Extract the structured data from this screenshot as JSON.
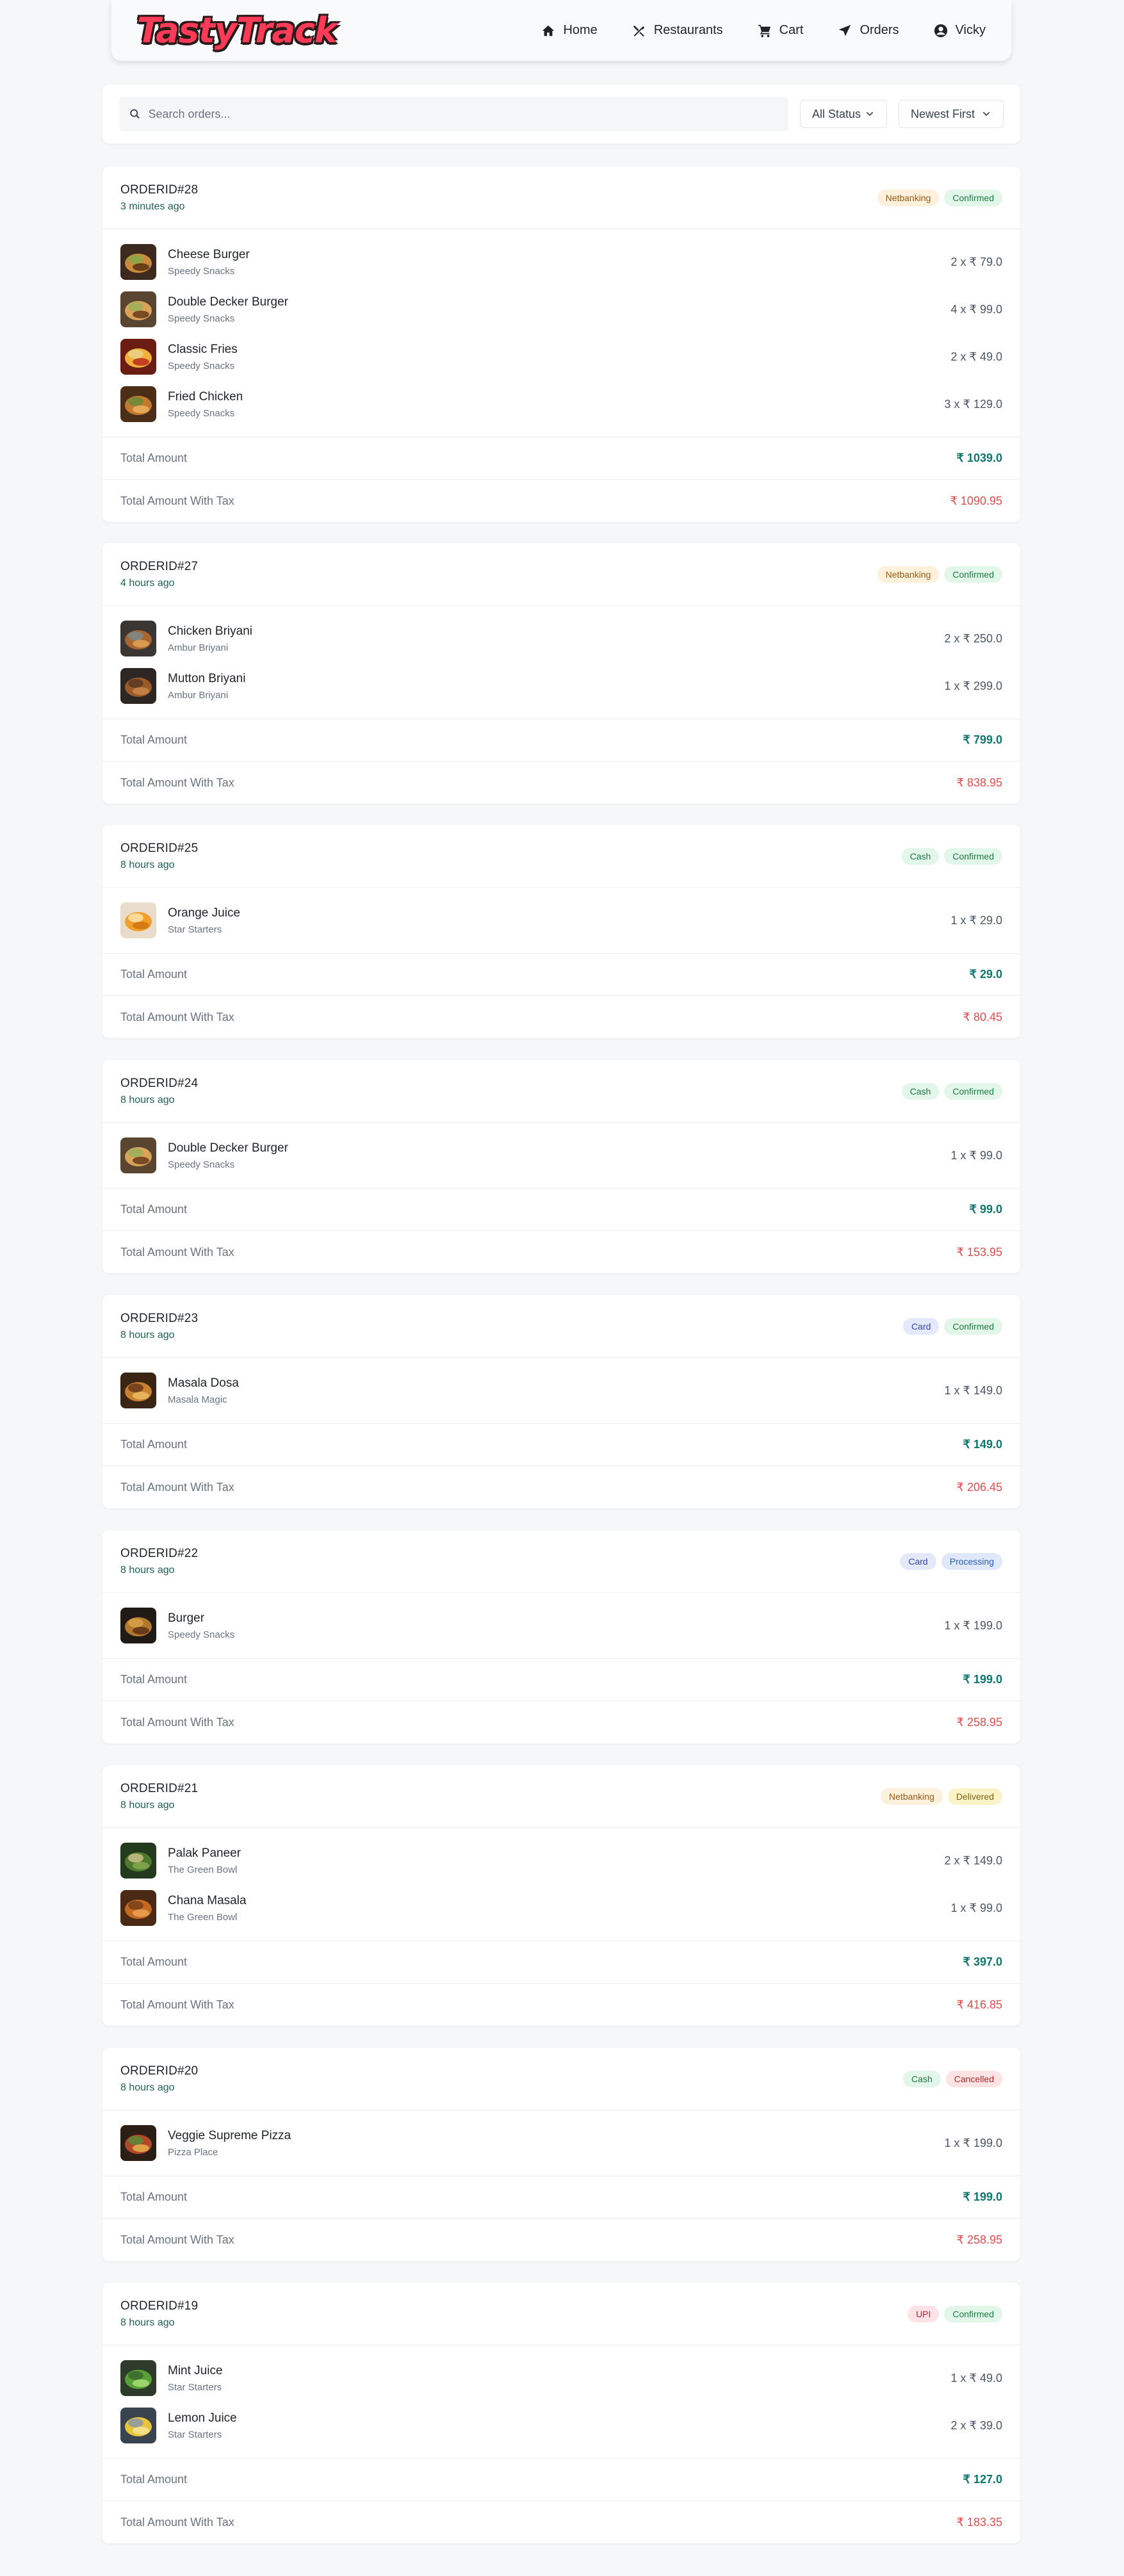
{
  "nav": {
    "logo": "TastyTrack",
    "links": [
      "Home",
      "Restaurants",
      "Cart",
      "Orders",
      "Vicky"
    ]
  },
  "toolbar": {
    "search_placeholder": "Search orders...",
    "status_filter": "All Status",
    "sort": "Newest First"
  },
  "labels": {
    "total": "Total Amount",
    "total_tax": "Total Amount With Tax"
  },
  "badge_colors": {
    "Netbanking": {
      "bg": "#fdf1dc",
      "fg": "#9a5a12"
    },
    "Cash": {
      "bg": "#e3f6ea",
      "fg": "#1e7a45"
    },
    "Card": {
      "bg": "#e3e8fb",
      "fg": "#3447a8"
    },
    "UPI": {
      "bg": "#fde3e8",
      "fg": "#b4283c"
    },
    "Confirmed": {
      "bg": "#e3f6ea",
      "fg": "#1e7a45"
    },
    "Processing": {
      "bg": "#dfe9fb",
      "fg": "#2b5cb8"
    },
    "Delivered": {
      "bg": "#fbf3c8",
      "fg": "#7a6410"
    },
    "Cancelled": {
      "bg": "#fde3e3",
      "fg": "#b42828"
    }
  },
  "orders": [
    {
      "id": "ORDERID#28",
      "time": "3 minutes ago",
      "payment": "Netbanking",
      "status": "Confirmed",
      "items": [
        {
          "name": "Cheese Burger",
          "restaurant": "Speedy Snacks",
          "qty": "2 x ₹ 79.0",
          "thumb": "burger"
        },
        {
          "name": "Double Decker Burger",
          "restaurant": "Speedy Snacks",
          "qty": "4 x ₹ 99.0",
          "thumb": "burger2"
        },
        {
          "name": "Classic Fries",
          "restaurant": "Speedy Snacks",
          "qty": "2 x ₹ 49.0",
          "thumb": "fries"
        },
        {
          "name": "Fried Chicken",
          "restaurant": "Speedy Snacks",
          "qty": "3 x ₹ 129.0",
          "thumb": "chicken"
        }
      ],
      "total": "₹ 1039.0",
      "total_tax": "₹ 1090.95"
    },
    {
      "id": "ORDERID#27",
      "time": "4 hours ago",
      "payment": "Netbanking",
      "status": "Confirmed",
      "items": [
        {
          "name": "Chicken Briyani",
          "restaurant": "Ambur Briyani",
          "qty": "2 x ₹ 250.0",
          "thumb": "biryani"
        },
        {
          "name": "Mutton Briyani",
          "restaurant": "Ambur Briyani",
          "qty": "1 x ₹ 299.0",
          "thumb": "biryani2"
        }
      ],
      "total": "₹ 799.0",
      "total_tax": "₹ 838.95"
    },
    {
      "id": "ORDERID#25",
      "time": "8 hours ago",
      "payment": "Cash",
      "status": "Confirmed",
      "items": [
        {
          "name": "Orange Juice",
          "restaurant": "Star Starters",
          "qty": "1 x ₹ 29.0",
          "thumb": "orange"
        }
      ],
      "total": "₹ 29.0",
      "total_tax": "₹ 80.45"
    },
    {
      "id": "ORDERID#24",
      "time": "8 hours ago",
      "payment": "Cash",
      "status": "Confirmed",
      "items": [
        {
          "name": "Double Decker Burger",
          "restaurant": "Speedy Snacks",
          "qty": "1 x ₹ 99.0",
          "thumb": "burger2"
        }
      ],
      "total": "₹ 99.0",
      "total_tax": "₹ 153.95"
    },
    {
      "id": "ORDERID#23",
      "time": "8 hours ago",
      "payment": "Card",
      "status": "Confirmed",
      "items": [
        {
          "name": "Masala Dosa",
          "restaurant": "Masala Magic",
          "qty": "1 x ₹ 149.0",
          "thumb": "dosa"
        }
      ],
      "total": "₹ 149.0",
      "total_tax": "₹ 206.45"
    },
    {
      "id": "ORDERID#22",
      "time": "8 hours ago",
      "payment": "Card",
      "status": "Processing",
      "items": [
        {
          "name": "Burger",
          "restaurant": "Speedy Snacks",
          "qty": "1 x ₹ 199.0",
          "thumb": "burger3"
        }
      ],
      "total": "₹ 199.0",
      "total_tax": "₹ 258.95"
    },
    {
      "id": "ORDERID#21",
      "time": "8 hours ago",
      "payment": "Netbanking",
      "status": "Delivered",
      "items": [
        {
          "name": "Palak Paneer",
          "restaurant": "The Green Bowl",
          "qty": "2 x ₹ 149.0",
          "thumb": "palak"
        },
        {
          "name": "Chana Masala",
          "restaurant": "The Green Bowl",
          "qty": "1 x ₹ 99.0",
          "thumb": "chana"
        }
      ],
      "total": "₹ 397.0",
      "total_tax": "₹ 416.85"
    },
    {
      "id": "ORDERID#20",
      "time": "8 hours ago",
      "payment": "Cash",
      "status": "Cancelled",
      "items": [
        {
          "name": "Veggie Supreme Pizza",
          "restaurant": "Pizza Place",
          "qty": "1 x ₹ 199.0",
          "thumb": "pizza"
        }
      ],
      "total": "₹ 199.0",
      "total_tax": "₹ 258.95"
    },
    {
      "id": "ORDERID#19",
      "time": "8 hours ago",
      "payment": "UPI",
      "status": "Confirmed",
      "items": [
        {
          "name": "Mint Juice",
          "restaurant": "Star Starters",
          "qty": "1 x ₹ 49.0",
          "thumb": "mint"
        },
        {
          "name": "Lemon Juice",
          "restaurant": "Star Starters",
          "qty": "2 x ₹ 39.0",
          "thumb": "lemon"
        }
      ],
      "total": "₹ 127.0",
      "total_tax": "₹ 183.35"
    }
  ]
}
